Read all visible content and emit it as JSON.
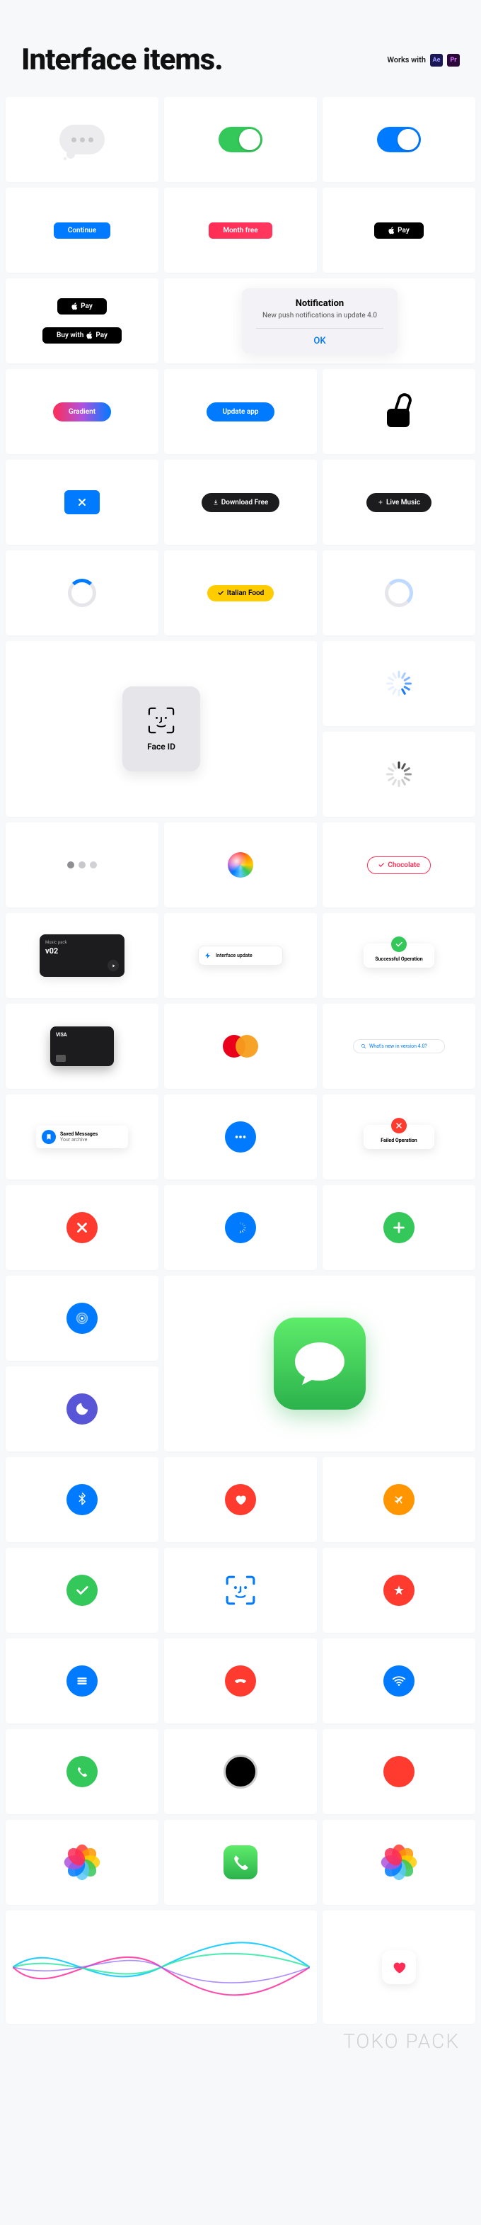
{
  "header": {
    "title": "Interface items.",
    "works_with_label": "Works with",
    "apps": {
      "ae": "Ae",
      "pr": "Pr"
    }
  },
  "buttons": {
    "continue": "Continue",
    "month_free": "Month free",
    "apple_pay": "Pay",
    "buy_with_apple_pay_prefix": "Buy with",
    "buy_with_apple_pay_suffix": "Pay",
    "gradient": "Gradient",
    "update_app": "Update app",
    "download_free": "Download Free",
    "live_music": "Live Music",
    "italian_food": "Italian Food",
    "chocolate": "Chocolate"
  },
  "notification": {
    "title": "Notification",
    "body": "New push notifications in update 4.0",
    "ok": "OK"
  },
  "faceid": {
    "label": "Face ID"
  },
  "cards": {
    "music_title": "Music pack",
    "music_sub": "v02",
    "interface_update": "Interface update",
    "success": "Successful Operation",
    "failed": "Failed Operation",
    "visa": "VISA",
    "search_placeholder": "What's new in version 4.0?",
    "toast_title": "Saved Messages",
    "toast_sub": "Your archive"
  },
  "footer": {
    "brand": "TOKO PACK"
  }
}
